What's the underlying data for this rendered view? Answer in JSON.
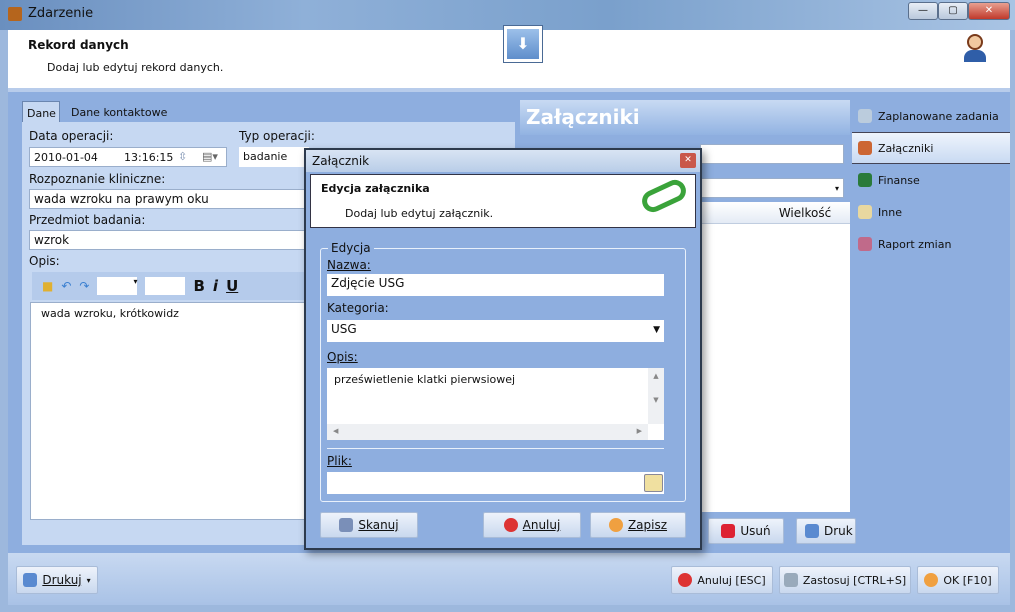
{
  "window": {
    "title": "Zdarzenie"
  },
  "header": {
    "title": "Rekord danych",
    "subtitle": "Dodaj lub edytuj rekord danych."
  },
  "tabs": [
    {
      "label": "Dane"
    },
    {
      "label": "Dane kontaktowe"
    }
  ],
  "form": {
    "date_label": "Data operacji:",
    "date": "2010-01-04",
    "time": "13:16:15",
    "type_label": "Typ operacji:",
    "type": "badanie",
    "diag_label": "Rozpoznanie kliniczne:",
    "diag": "wada wzroku na prawym oku",
    "subject_label": "Przedmiot badania:",
    "subject": "wzrok",
    "desc_label": "Opis:",
    "desc": "wada wzroku, krótkowidz",
    "toolbar": {
      "bold": "B",
      "italic": "i",
      "underline": "U"
    }
  },
  "attachments": {
    "title": "Załączniki",
    "col_size": "Wielkość",
    "delete": "Usuń",
    "print": "Druk"
  },
  "sidebar": {
    "items": [
      {
        "label": "Zaplanowane zadania"
      },
      {
        "label": "Załączniki"
      },
      {
        "label": "Finanse"
      },
      {
        "label": "Inne"
      },
      {
        "label": "Raport zmian"
      }
    ]
  },
  "footer": {
    "print": "Drukuj",
    "cancel": "Anuluj [ESC]",
    "apply": "Zastosuj [CTRL+S]",
    "ok": "OK [F10]"
  },
  "dialog": {
    "title": "Załącznik",
    "header_title": "Edycja załącznika",
    "header_subtitle": "Dodaj lub edytuj załącznik.",
    "group": "Edycja",
    "name_label": "Nazwa:",
    "name": "Zdjęcie USG",
    "cat_label": "Kategoria:",
    "cat": "USG",
    "desc_label": "Opis:",
    "desc": "prześwietlenie klatki pierwsiowej",
    "file_label": "Plik:",
    "file": "",
    "scan": "Skanuj",
    "cancel": "Anuluj",
    "save": "Zapisz"
  }
}
